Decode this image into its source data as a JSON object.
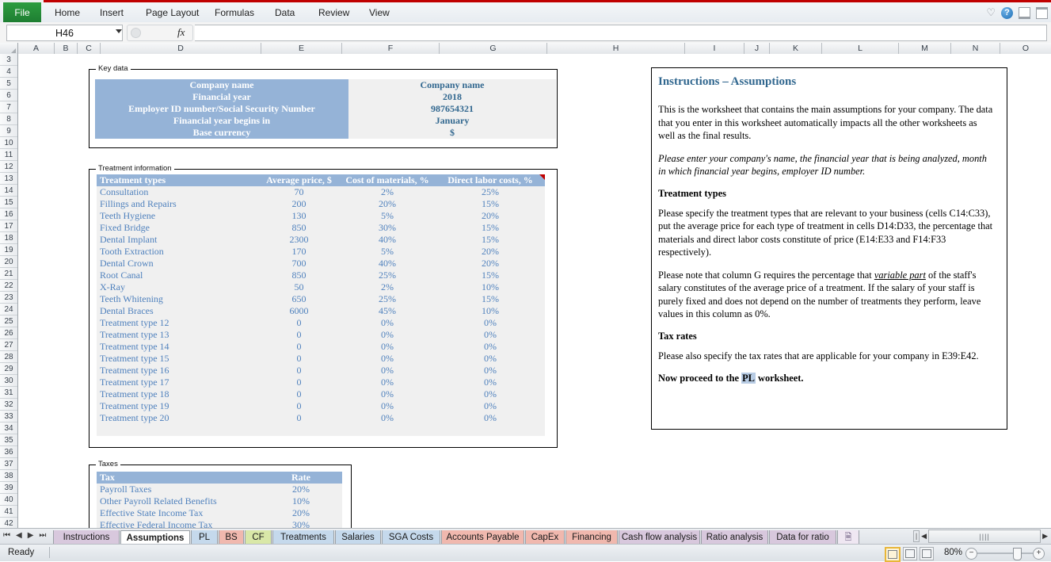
{
  "window": {
    "ribbon_tabs": [
      "File",
      "Home",
      "Insert",
      "Page Layout",
      "Formulas",
      "Data",
      "Review",
      "View"
    ],
    "help_icons": [
      "heart-icon",
      "help-icon",
      "minimize-icon",
      "close-icon"
    ]
  },
  "formula_bar": {
    "name_box_value": "H46",
    "formula_value": "",
    "fx_label": "fx"
  },
  "grid": {
    "columns": [
      "A",
      "B",
      "C",
      "D",
      "E",
      "F",
      "G",
      "H",
      "I",
      "J",
      "K",
      "L",
      "M",
      "N",
      "O"
    ],
    "rows": [
      3,
      4,
      5,
      6,
      7,
      8,
      9,
      10,
      11,
      12,
      13,
      14,
      15,
      16,
      17,
      18,
      19,
      20,
      21,
      22,
      23,
      24,
      25,
      26,
      27,
      28,
      29,
      30,
      31,
      32,
      33,
      34,
      35,
      36,
      37,
      38,
      39,
      40,
      41,
      42
    ]
  },
  "key_data": {
    "group_label": "Key data",
    "labels": [
      "Company name",
      "Financial year",
      "Employer ID number/Social Security Number",
      "Financial year begins in",
      "Base currency"
    ],
    "values": [
      "Company name",
      "2018",
      "987654321",
      "January",
      "$"
    ]
  },
  "treatment_information": {
    "group_label": "Treatment information",
    "headers": [
      "Treatment types",
      "Average price, $",
      "Cost of materials, %",
      "Direct labor costs, %"
    ],
    "rows": [
      [
        "Consultation",
        "70",
        "2%",
        "25%"
      ],
      [
        "Fillings and Repairs",
        "200",
        "20%",
        "15%"
      ],
      [
        "Teeth Hygiene",
        "130",
        "5%",
        "20%"
      ],
      [
        "Fixed Bridge",
        "850",
        "30%",
        "15%"
      ],
      [
        "Dental Implant",
        "2300",
        "40%",
        "15%"
      ],
      [
        "Tooth Extraction",
        "170",
        "5%",
        "20%"
      ],
      [
        "Dental Crown",
        "700",
        "40%",
        "20%"
      ],
      [
        "Root Canal",
        "850",
        "25%",
        "15%"
      ],
      [
        "X-Ray",
        "50",
        "2%",
        "10%"
      ],
      [
        "Teeth Whitening",
        "650",
        "25%",
        "15%"
      ],
      [
        "Dental Braces",
        "6000",
        "45%",
        "10%"
      ],
      [
        "Treatment type 12",
        "0",
        "0%",
        "0%"
      ],
      [
        "Treatment type 13",
        "0",
        "0%",
        "0%"
      ],
      [
        "Treatment type 14",
        "0",
        "0%",
        "0%"
      ],
      [
        "Treatment type 15",
        "0",
        "0%",
        "0%"
      ],
      [
        "Treatment type 16",
        "0",
        "0%",
        "0%"
      ],
      [
        "Treatment type 17",
        "0",
        "0%",
        "0%"
      ],
      [
        "Treatment type 18",
        "0",
        "0%",
        "0%"
      ],
      [
        "Treatment type 19",
        "0",
        "0%",
        "0%"
      ],
      [
        "Treatment type 20",
        "0",
        "0%",
        "0%"
      ]
    ]
  },
  "taxes": {
    "group_label": "Taxes",
    "headers": [
      "Tax",
      "Rate"
    ],
    "rows": [
      [
        "Payroll Taxes",
        "20%"
      ],
      [
        "Other Payroll Related Benefits",
        "10%"
      ],
      [
        "Effective State Income Tax",
        "20%"
      ],
      [
        "Effective Federal Income Tax",
        "30%"
      ]
    ]
  },
  "instructions": {
    "title": "Instructions – Assumptions",
    "p1": "This is the worksheet that contains the main assumptions for your company. The data that you enter in this worksheet automatically impacts all the other worksheets as well as the final results.",
    "p2": "Please enter your company's name, the financial year that is being analyzed, month in which financial year begins, employer ID number.",
    "h1": "Treatment types",
    "p3": "Please specify the treatment types that are relevant to your business (cells C14:C33), put the average price for each type of treatment in cells D14:D33, the percentage that materials and direct labor costs constitute of price (E14:E33 and F14:F33 respectively).",
    "p4_a": "Please note that column G requires the percentage that ",
    "p4_em": "variable part",
    "p4_b": " of the staff's salary constitutes of the average price of a treatment. If the salary of your staff is purely fixed and does not depend on the number of treatments they perform, leave values in this column as 0%.",
    "h2": "Tax rates",
    "p5": "Please also specify the tax rates that are applicable for your company in E39:E42.",
    "p6_a": "Now proceed to the ",
    "p6_hl": "PL",
    "p6_b": " worksheet."
  },
  "sheet_tabs": {
    "nav_first": "⏮",
    "nav_prev": "◀",
    "nav_next": "▶",
    "nav_last": "⏭",
    "tabs": [
      {
        "label": "Instructions",
        "color": "#d8c8dd",
        "active": false
      },
      {
        "label": "Assumptions",
        "color": "#ffffff",
        "active": true
      },
      {
        "label": "PL",
        "color": "#c5d9ec",
        "active": false
      },
      {
        "label": "BS",
        "color": "#f0b8ae",
        "active": false
      },
      {
        "label": "CF",
        "color": "#d9e8a8",
        "active": false
      },
      {
        "label": "Treatments",
        "color": "#c5d9ec",
        "active": false
      },
      {
        "label": "Salaries",
        "color": "#c5d9ec",
        "active": false
      },
      {
        "label": "SGA Costs",
        "color": "#c5d9ec",
        "active": false
      },
      {
        "label": "Accounts Payable",
        "color": "#f0b8ae",
        "active": false
      },
      {
        "label": "CapEx",
        "color": "#f0b8ae",
        "active": false
      },
      {
        "label": "Financing",
        "color": "#f0b8ae",
        "active": false
      },
      {
        "label": "Cash flow analysis",
        "color": "#d8c8dd",
        "active": false
      },
      {
        "label": "Ratio analysis",
        "color": "#d8c8dd",
        "active": false
      },
      {
        "label": "Data for ratio",
        "color": "#d8c8dd",
        "active": false
      }
    ],
    "new_sheet_icon": "new-sheet-icon"
  },
  "status_bar": {
    "mode": "Ready",
    "zoom": "80%",
    "view_buttons": [
      "normal-view-icon",
      "page-layout-view-icon",
      "page-break-view-icon"
    ],
    "zoom_out": "−",
    "zoom_in": "+"
  },
  "colors": {
    "header_blue": "#95b3d7",
    "cell_text_blue": "#4f81bd",
    "title_blue": "#31678f",
    "cell_bg": "#f0f0f0",
    "file_tab_green": "#1e7e32",
    "accent_red": "#c00000"
  }
}
